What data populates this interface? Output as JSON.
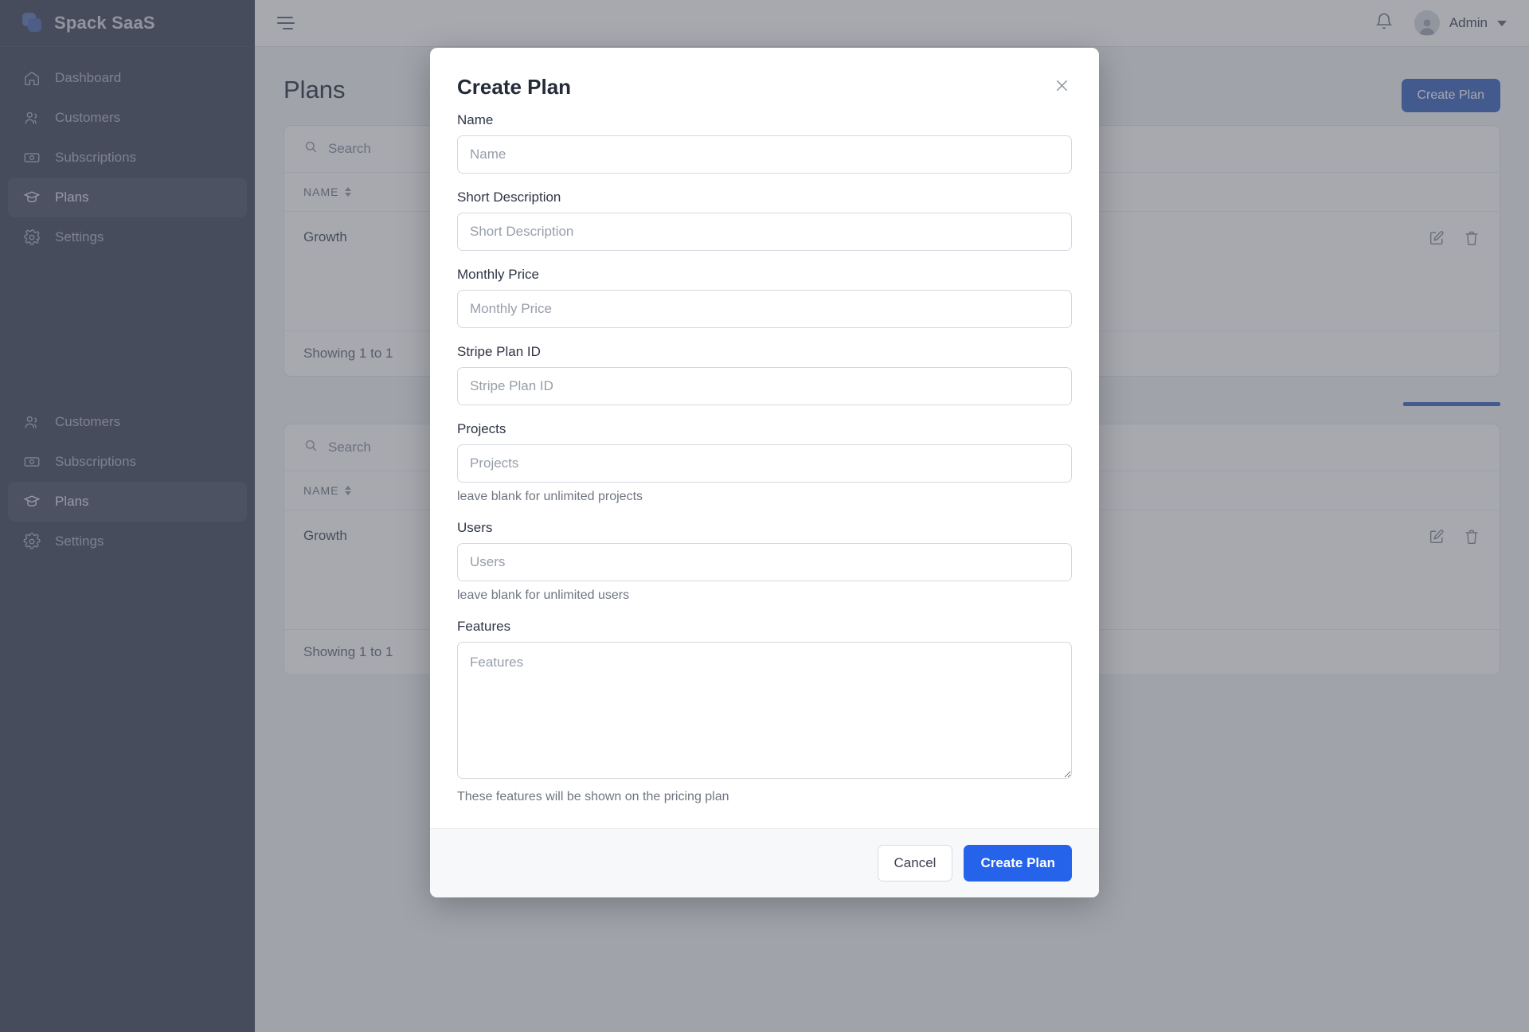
{
  "sidebar": {
    "brand": "Spack SaaS",
    "brand_logo_icon": "stacked-squares-icon",
    "primary_items": [
      {
        "label": "Dashboard",
        "icon": "home-icon",
        "active": false
      },
      {
        "label": "Customers",
        "icon": "users-icon",
        "active": false
      },
      {
        "label": "Subscriptions",
        "icon": "banknote-icon",
        "active": false
      },
      {
        "label": "Plans",
        "icon": "graduation-cap-icon",
        "active": true
      },
      {
        "label": "Settings",
        "icon": "gear-icon",
        "active": false
      }
    ],
    "secondary_items": [
      {
        "label": "Customers",
        "icon": "users-icon",
        "active": false
      },
      {
        "label": "Subscriptions",
        "icon": "banknote-icon",
        "active": false
      },
      {
        "label": "Plans",
        "icon": "graduation-cap-icon",
        "active": true
      },
      {
        "label": "Settings",
        "icon": "gear-icon",
        "active": false
      }
    ]
  },
  "topbar": {
    "menu_icon": "hamburger-icon",
    "notifications_icon": "bell-icon",
    "avatar_icon": "user-avatar-icon",
    "user_name": "Admin",
    "chevron_icon": "chevron-down-icon"
  },
  "page": {
    "title": "Plans",
    "create_button": "Create Plan",
    "search_placeholder": "Search",
    "search_icon": "search-icon",
    "table": {
      "columns": [
        "NAME"
      ],
      "sort_icon": "sort-updown-icon",
      "rows": [
        {
          "name": "Growth",
          "edit_icon": "edit-pencil-icon",
          "delete_icon": "trash-icon"
        }
      ],
      "footer": "Showing 1 to 1"
    },
    "second_panel": {
      "search_placeholder": "Search",
      "columns": [
        "NAME"
      ],
      "rows": [
        {
          "name": "Growth",
          "edit_icon": "edit-pencil-icon",
          "delete_icon": "trash-icon"
        }
      ],
      "footer": "Showing 1 to 1"
    }
  },
  "modal": {
    "title": "Create Plan",
    "close_icon": "close-x-icon",
    "fields": {
      "name": {
        "label": "Name",
        "value": "",
        "placeholder": "Name"
      },
      "short_desc": {
        "label": "Short Description",
        "value": "",
        "placeholder": "Short Description"
      },
      "price": {
        "label": "Monthly Price",
        "value": "",
        "placeholder": "Monthly Price"
      },
      "stripe_id": {
        "label": "Stripe Plan ID",
        "value": "",
        "placeholder": "Stripe Plan ID"
      },
      "projects": {
        "label": "Projects",
        "value": "",
        "placeholder": "Projects",
        "help": "leave blank for unlimited projects"
      },
      "users": {
        "label": "Users",
        "value": "",
        "placeholder": "Users",
        "help": "leave blank for unlimited users"
      },
      "features": {
        "label": "Features",
        "value": "",
        "placeholder": "Features",
        "help": "These features will be shown on the pricing plan"
      }
    },
    "cancel_label": "Cancel",
    "submit_label": "Create Plan"
  },
  "colors": {
    "sidebar_bg": "#4f5668",
    "accent_blue": "#2563eb",
    "muted_blue": "#4a6fc4",
    "overlay": "rgba(60,64,78,0.45)"
  }
}
